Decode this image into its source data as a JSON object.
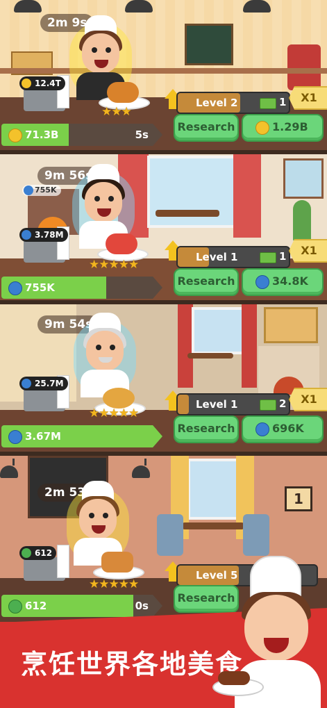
{
  "panels": [
    {
      "timer": "2m 9s",
      "register_cash": "12.4T",
      "level": "Level 2",
      "money_count": "1",
      "multiplier": "X1",
      "research_label": "Research",
      "research_cost": "1.29B",
      "production_value": "71.3B",
      "production_time": "5s",
      "production_progress": 0.42,
      "stars": "★★★",
      "coin_color": "#f3c22b"
    },
    {
      "timer": "9m 56s",
      "small_cash": "755K",
      "register_cash": "3.78M",
      "level": "Level 1",
      "money_count": "1",
      "multiplier": "X1",
      "research_label": "Research",
      "research_cost": "34.8K",
      "production_value": "755K",
      "production_progress": 0.65,
      "stars": "★★★★★",
      "coin_color": "#3a7fd1"
    },
    {
      "timer": "9m 54s",
      "register_cash": "25.7M",
      "level": "Level 1",
      "money_count": "2",
      "multiplier": "X1",
      "research_label": "Research",
      "research_cost": "696K",
      "production_value": "3.67M",
      "production_progress": 1.0,
      "stars": "★★★★★",
      "coin_color": "#3a7fd1"
    },
    {
      "timer": "2m 53s",
      "register_cash": "612",
      "level": "Level 5",
      "research_label": "Research",
      "production_value": "612",
      "production_time": "0s",
      "production_progress": 0.82,
      "stars": "★★★★★",
      "coin_color": "#4caf50",
      "wall_number": "1"
    }
  ],
  "banner": {
    "text": "烹饪世界各地美食"
  }
}
